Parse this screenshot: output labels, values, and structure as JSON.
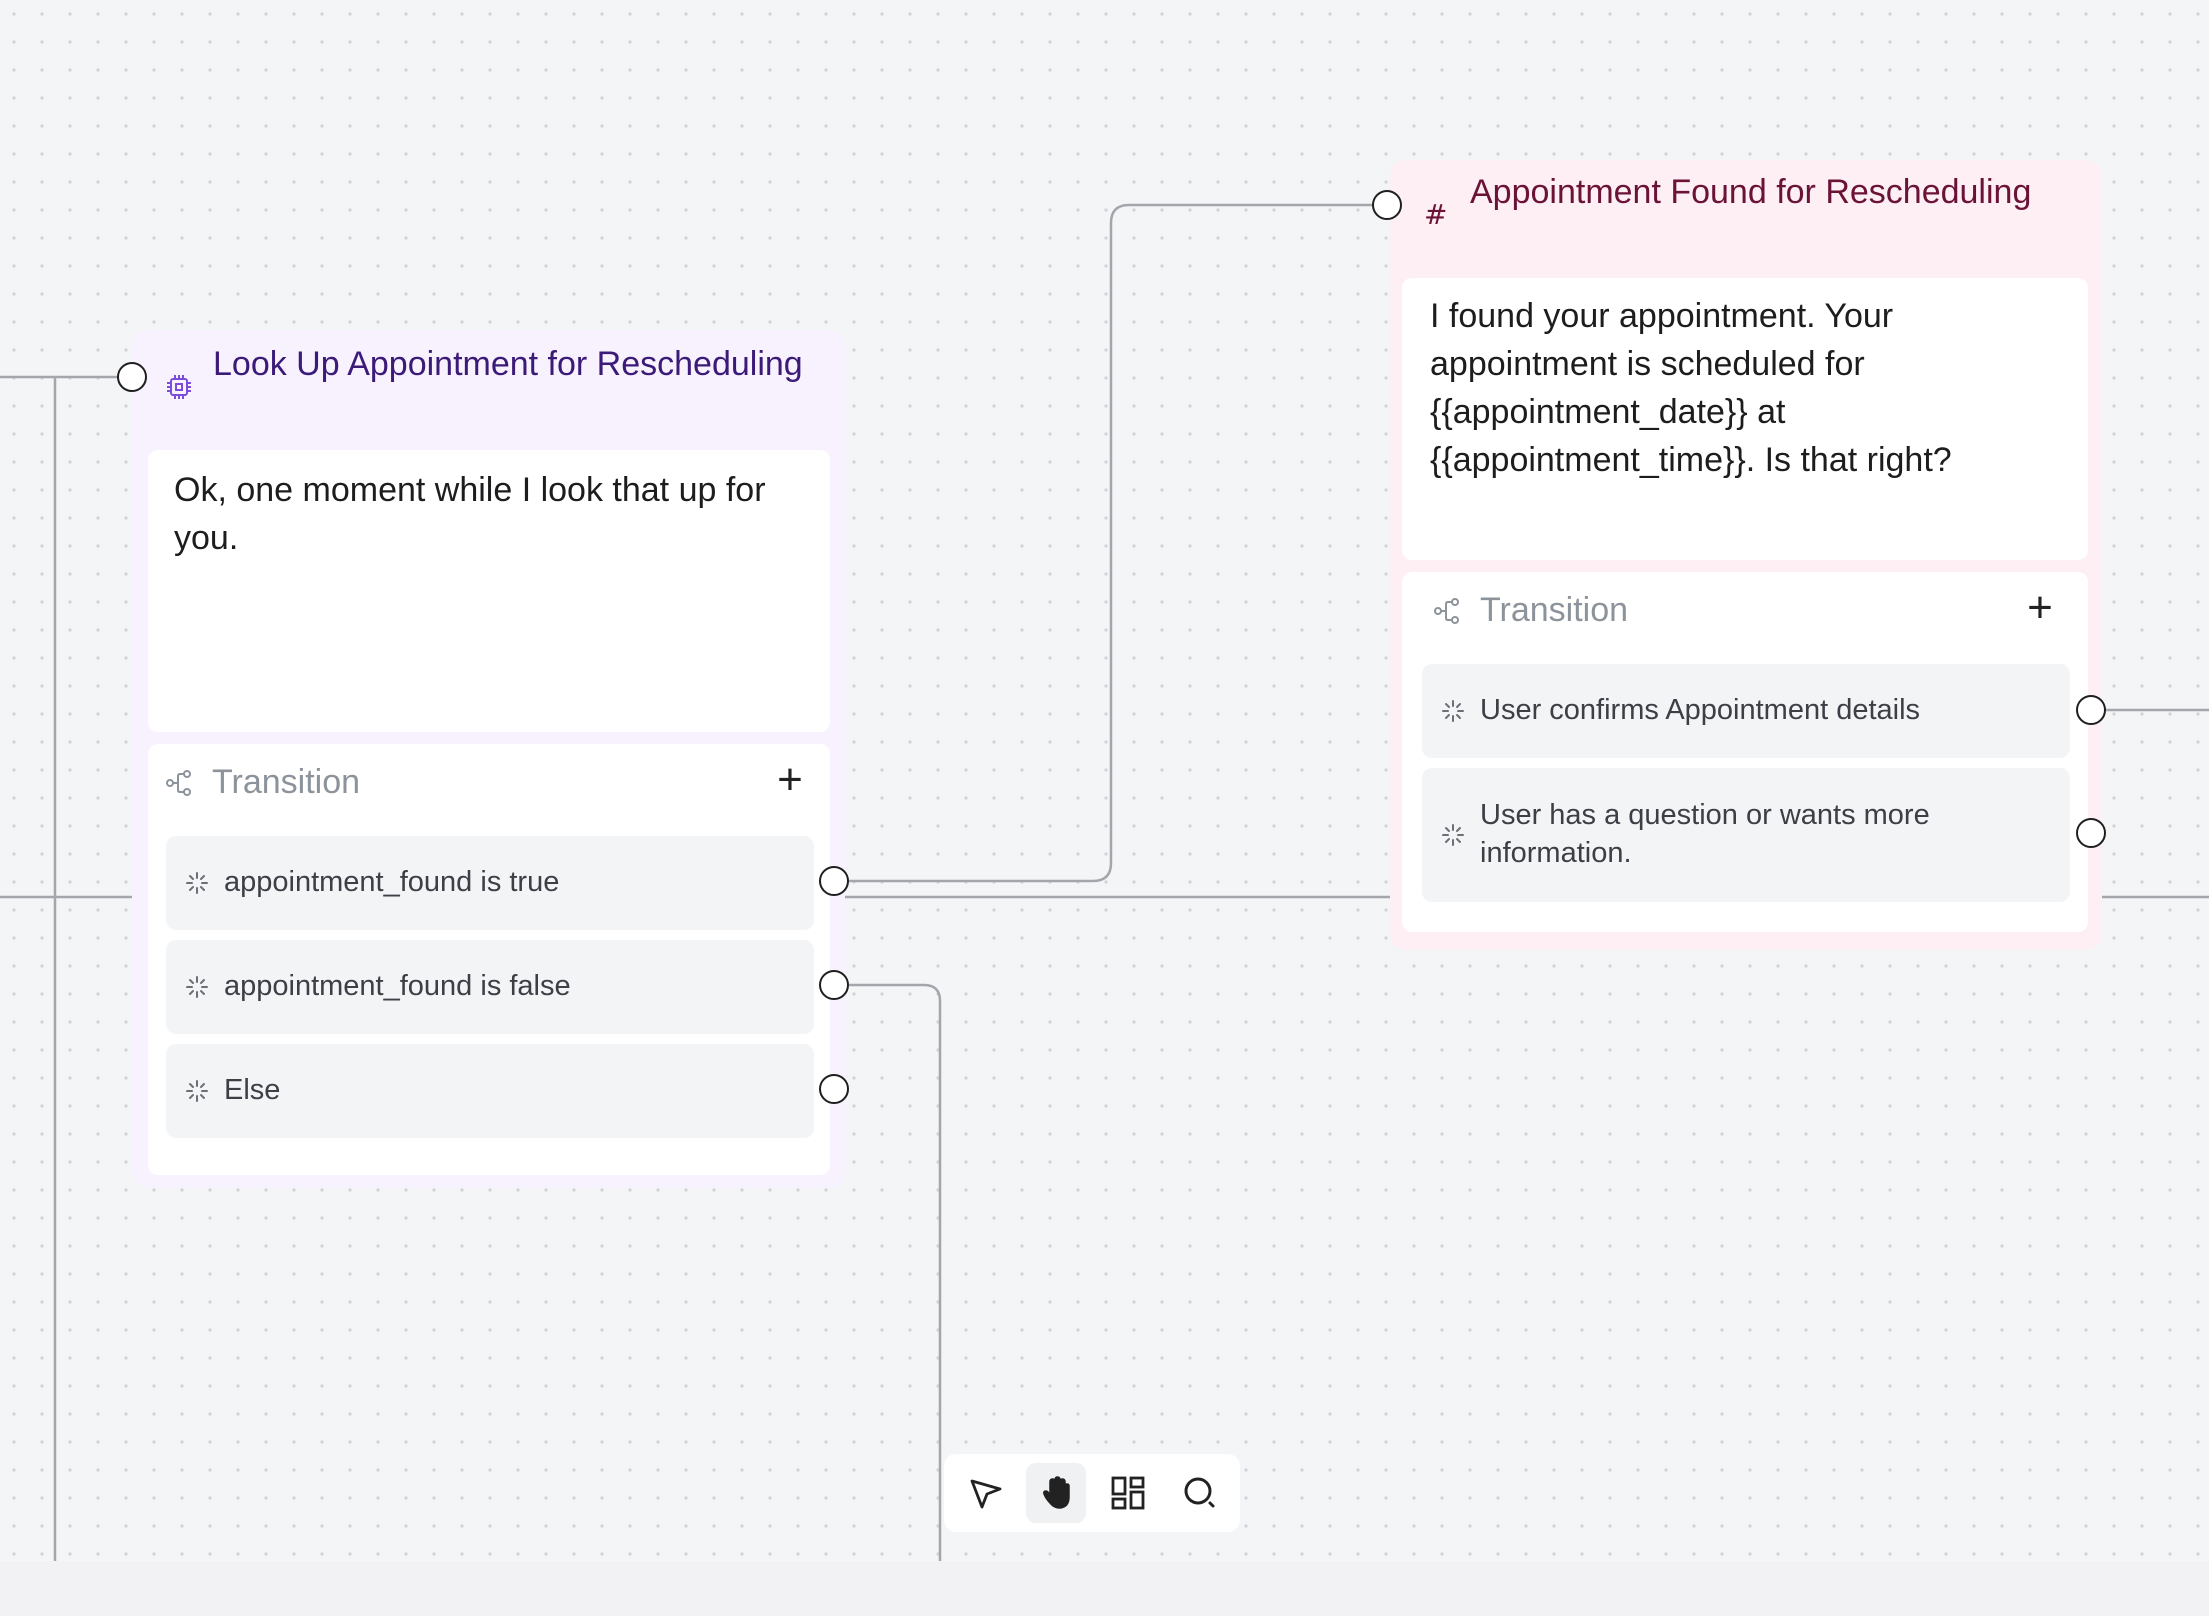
{
  "canvas": {
    "background_color": "#f4f5f7",
    "edge_color": "#a3a6ab",
    "handle_color": "#1f1f1f"
  },
  "nodes": {
    "lookup": {
      "title": "Look Up Appointment for Rescheduling",
      "icon": "chip-icon",
      "message": "Ok, one moment while I look that up for you.",
      "accent_color": "#3b1a78",
      "background_color": "#f7f2fe",
      "transition": {
        "label": "Transition",
        "add_icon": "plus-icon",
        "conditions": [
          "appointment_found is true",
          "appointment_found is false",
          "Else"
        ]
      }
    },
    "found": {
      "title": "Appointment Found for Rescheduling",
      "icon": "hash-icon",
      "icon_text": "#",
      "message": "I found your appointment. Your appointment is scheduled for {{appointment_date}} at {{appointment_time}}. Is that right?",
      "accent_color": "#6b1237",
      "background_color": "#fdeff4",
      "transition": {
        "label": "Transition",
        "add_icon": "plus-icon",
        "conditions": [
          "User confirms Appointment details",
          "User has a question or wants more information."
        ]
      }
    }
  },
  "toolbar": {
    "tools": [
      {
        "name": "select",
        "icon": "cursor-arrow-icon",
        "active": false
      },
      {
        "name": "pan",
        "icon": "hand-icon",
        "active": true
      },
      {
        "name": "layout",
        "icon": "grid-layout-icon",
        "active": false
      },
      {
        "name": "search",
        "icon": "search-icon",
        "active": false
      }
    ]
  }
}
